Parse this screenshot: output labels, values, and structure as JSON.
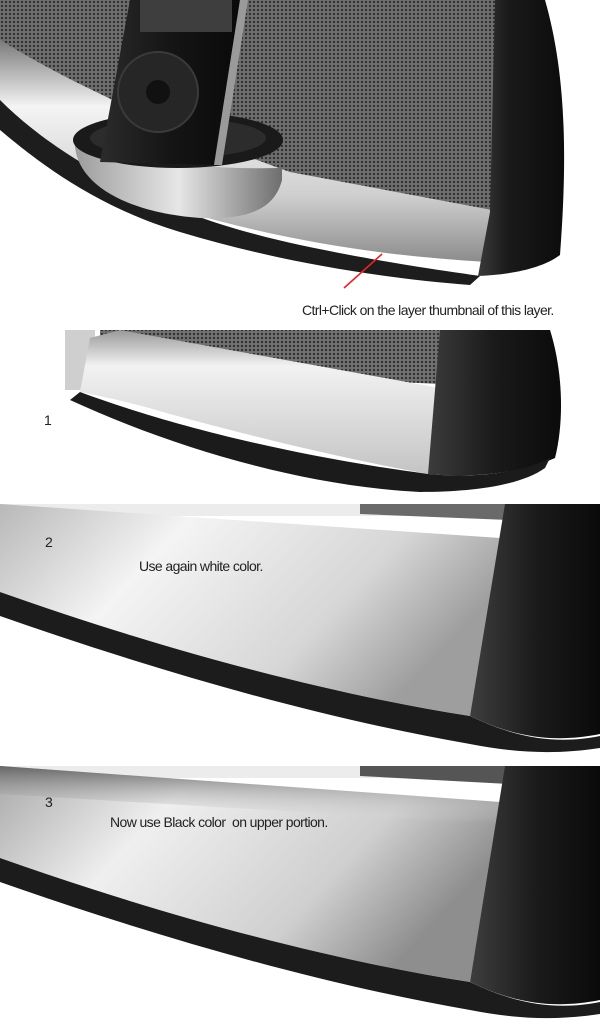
{
  "panel_top": {
    "annotation": "Ctrl+Click on the layer thumbnail of this layer."
  },
  "steps": [
    {
      "number": "1",
      "caption": ""
    },
    {
      "number": "2",
      "caption": "Use again white color."
    },
    {
      "number": "3",
      "caption": "Now use Black color  on upper portion."
    }
  ],
  "colors": {
    "speaker_body": "#1b1b1b",
    "silver_light": "#f2f2f2",
    "silver_dark": "#8a8a8a",
    "grille": "#5a5a5a",
    "annotation_line": "#e8232a"
  }
}
